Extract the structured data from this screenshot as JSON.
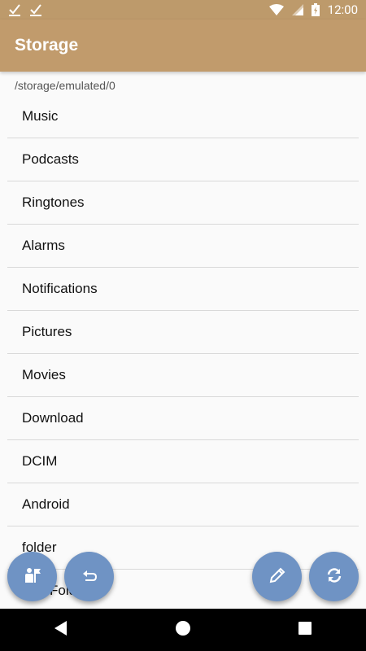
{
  "status_bar": {
    "time": "12:00",
    "left_icons": [
      "check-notification-icon",
      "check-notification-icon"
    ],
    "right_icons": [
      "wifi-icon",
      "cell-signal-icon",
      "battery-charging-icon"
    ]
  },
  "app_bar": {
    "title": "Storage"
  },
  "path": "/storage/emulated/0",
  "folders": [
    "Music",
    "Podcasts",
    "Ringtones",
    "Alarms",
    "Notifications",
    "Pictures",
    "Movies",
    "Download",
    "DCIM",
    "Android",
    "folder",
    "NewFolder"
  ],
  "fabs": {
    "user_flag": "user-flag-icon",
    "undo": "undo-icon",
    "edit": "pencil-icon",
    "sync": "sync-icon"
  },
  "nav_bar": {
    "icons": [
      "back-icon",
      "home-icon",
      "recents-icon"
    ]
  },
  "colors": {
    "app_bar": "#c19b6c",
    "fab": "#6f93c4",
    "status_bar": "#bd9a6b"
  }
}
